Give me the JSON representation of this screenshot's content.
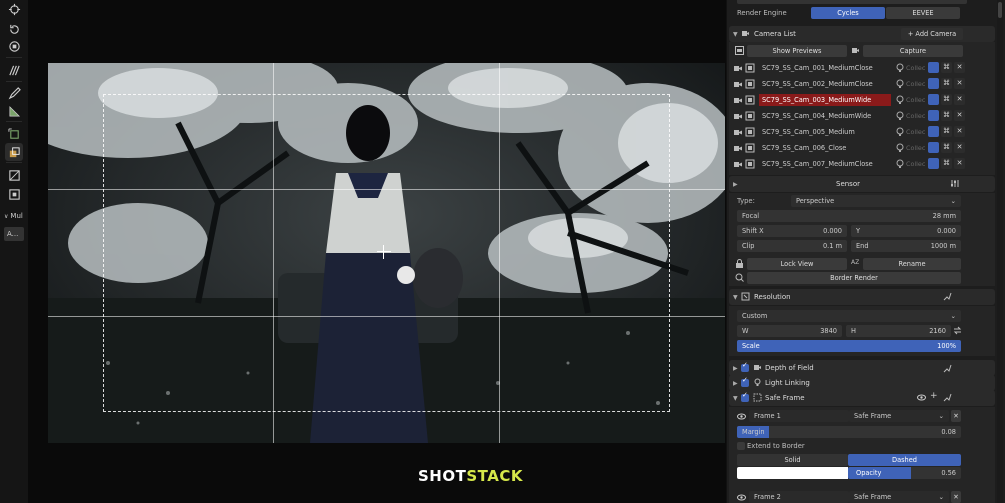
{
  "render": {
    "label": "Render Engine",
    "options": [
      "Cycles",
      "EEVEE"
    ],
    "selected": "Cycles"
  },
  "camera_list": {
    "title": "Camera List",
    "add_label": "+ Add Camera",
    "show_previews": "Show Previews",
    "capture": "Capture",
    "collection_label": "Collec",
    "cameras": [
      {
        "name": "SC79_SS_Cam_001_MediumClose",
        "selected": false
      },
      {
        "name": "SC79_SS_Cam_002_MediumClose",
        "selected": false
      },
      {
        "name": "SC79_SS_Cam_003_MediumWide",
        "selected": true
      },
      {
        "name": "SC79_SS_Cam_004_MediumWide",
        "selected": false
      },
      {
        "name": "SC79_SS_Cam_005_Medium",
        "selected": false
      },
      {
        "name": "SC79_SS_Cam_006_Close",
        "selected": false
      },
      {
        "name": "SC79_SS_Cam_007_MediumClose",
        "selected": false
      }
    ]
  },
  "sensor": {
    "title": "Sensor",
    "type_label": "Type:",
    "type_value": "Perspective",
    "focal_label": "Focal",
    "focal_value": "28 mm",
    "shift_x_label": "Shift X",
    "shift_x_value": "0.000",
    "y_label": "Y",
    "y_value": "0.000",
    "clip_label": "Clip",
    "clip_value": "0.1 m",
    "end_label": "End",
    "end_value": "1000 m",
    "lock_view": "Lock View",
    "sort_label": "AZ",
    "rename": "Rename",
    "border_render": "Border Render"
  },
  "resolution": {
    "title": "Resolution",
    "preset": "Custom",
    "w_label": "W",
    "w_value": "3840",
    "h_label": "H",
    "h_value": "2160",
    "scale_label": "Scale",
    "scale_value": "100%",
    "scale_fraction": 1.0
  },
  "panels": {
    "depth_of_field": "Depth of Field",
    "light_linking": "Light Linking",
    "safe_frame": "Safe Frame"
  },
  "safe_frame": {
    "frame1_label": "Frame 1",
    "frame1_type": "Safe Frame",
    "margin_label": "Margin",
    "margin_value": "0.08",
    "extend_label": "Extend to Border",
    "style_options": [
      "Solid",
      "Dashed"
    ],
    "style_selected": "Dashed",
    "opacity_label": "Opacity",
    "opacity_value": "0.56",
    "frame2_label": "Frame 2",
    "frame2_type": "Safe Frame"
  },
  "toolbar": {
    "mul_label": "Mul",
    "a_label": "A..."
  },
  "watermark": {
    "part1": "SHOT",
    "part2": "STACK"
  },
  "colors": {
    "accent_blue": "#3f63b8",
    "selected_red": "#8a1a1a",
    "logo_accent": "#d6e84a"
  }
}
